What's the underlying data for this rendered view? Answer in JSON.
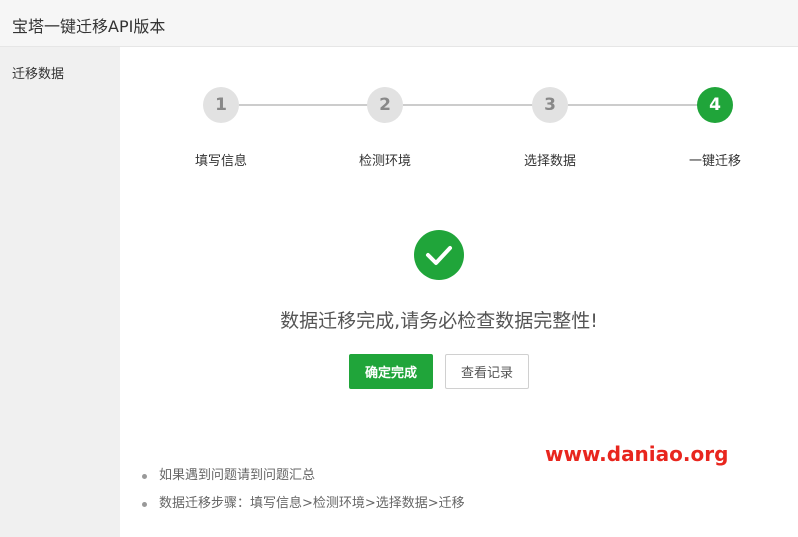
{
  "window": {
    "title": "宝塔一键迁移API版本"
  },
  "sidebar": {
    "items": [
      {
        "label": "迁移数据"
      }
    ]
  },
  "steps": [
    {
      "number": "1",
      "label": "填写信息",
      "active": false
    },
    {
      "number": "2",
      "label": "检测环境",
      "active": false
    },
    {
      "number": "3",
      "label": "选择数据",
      "active": false
    },
    {
      "number": "4",
      "label": "一键迁移",
      "active": true
    }
  ],
  "result": {
    "message": "数据迁移完成,请务必检查数据完整性!",
    "confirm_label": "确定完成",
    "log_label": "查看记录"
  },
  "tips": [
    "如果遇到问题请到问题汇总",
    "数据迁移步骤：填写信息>检测环境>选择数据>迁移"
  ],
  "watermark": "www.daniao.org",
  "colors": {
    "accent": "#20a53a",
    "watermark": "#e8261e"
  }
}
